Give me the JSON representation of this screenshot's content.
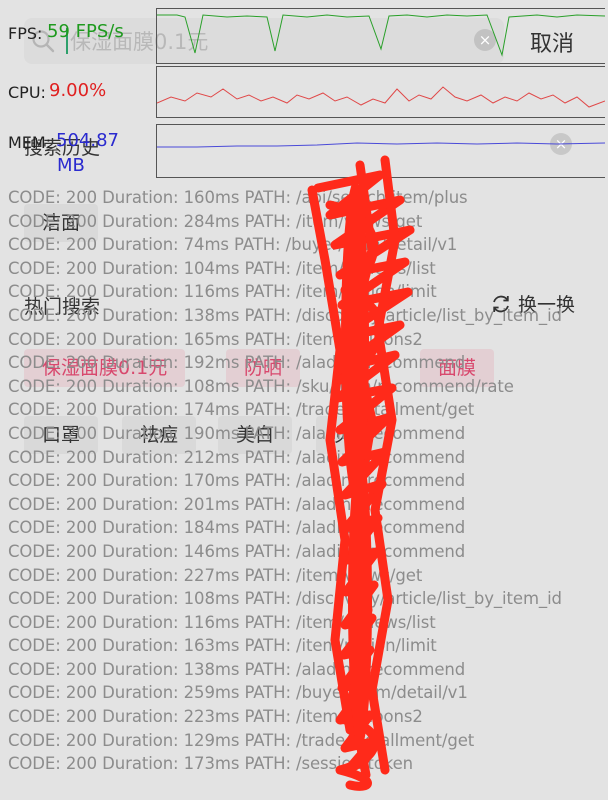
{
  "search": {
    "placeholder": "保湿面膜0.1元",
    "clear_icon": "close-circle-icon",
    "cancel_label": "取消"
  },
  "history": {
    "title": "搜索历史",
    "items": [
      "洁面"
    ],
    "clear_icon": "close-circle-icon"
  },
  "hot": {
    "title": "热门搜索",
    "refresh_label": "换一换",
    "items": [
      {
        "label": "保湿面膜0.1元",
        "highlight": true
      },
      {
        "label": "防晒",
        "highlight": true
      },
      {
        "label": "面膜",
        "highlight": true
      },
      {
        "label": "口罩",
        "highlight": false
      },
      {
        "label": "祛痘",
        "highlight": false
      },
      {
        "label": "美白",
        "highlight": false
      },
      {
        "label": "贝卡",
        "highlight": false
      }
    ]
  },
  "overlay": {
    "fps_label": "FPS:",
    "fps_value": "59 FPS/s",
    "fps_color": "#1e9a1e",
    "cpu_label": "CPU:",
    "cpu_value": "9.00%",
    "cpu_color": "#e02020",
    "mem_label": "MEM:",
    "mem_value": "504.87",
    "mem_unit": "MB",
    "mem_color": "#2a2acf",
    "log_lines": [
      "CODE: 200 Duration: 160ms  PATH: /api/search/item/plus",
      "CODE: 200 Duration: 284ms  PATH: /item/views/get",
      "CODE: 200 Duration: 74ms  PATH: /buyer/item/detail/v1",
      "CODE: 200 Duration: 104ms  PATH: /item/reviews/list",
      "CODE: 200 Duration: 116ms  PATH: /item/region/limit",
      "CODE: 200 Duration: 138ms  PATH: /discovery/article/list_by_item_id",
      "CODE: 200 Duration: 165ms  PATH: /item/coupons2",
      "CODE: 200 Duration: 192ms  PATH: /alading/recommend",
      "CODE: 200 Duration: 108ms  PATH: /sku/item/recommend/rate",
      "CODE: 200 Duration: 174ms  PATH: /trade/installment/get",
      "CODE: 200 Duration: 190ms  PATH: /alading/recommend",
      "CODE: 200 Duration: 212ms  PATH: /alading/recommend",
      "CODE: 200 Duration: 170ms  PATH: /alading/recommend",
      "CODE: 200 Duration: 201ms  PATH: /alading/recommend",
      "CODE: 200 Duration: 184ms  PATH: /alading/recommend",
      "CODE: 200 Duration: 146ms  PATH: /alading/recommend",
      "CODE: 200 Duration: 227ms  PATH: /item/views/get",
      "CODE: 200 Duration: 108ms  PATH: /discovery/article/list_by_item_id",
      "CODE: 200 Duration: 116ms  PATH: /item/reviews/list",
      "CODE: 200 Duration: 163ms  PATH: /item/region/limit",
      "CODE: 200 Duration: 138ms  PATH: /alading/recommend",
      "CODE: 200 Duration: 259ms  PATH: /buyer/item/detail/v1",
      "CODE: 200 Duration: 223ms  PATH: /item/coupons2",
      "CODE: 200 Duration: 129ms  PATH: /trade/installment/get",
      "CODE: 200 Duration: 173ms  PATH: /session/token"
    ]
  }
}
